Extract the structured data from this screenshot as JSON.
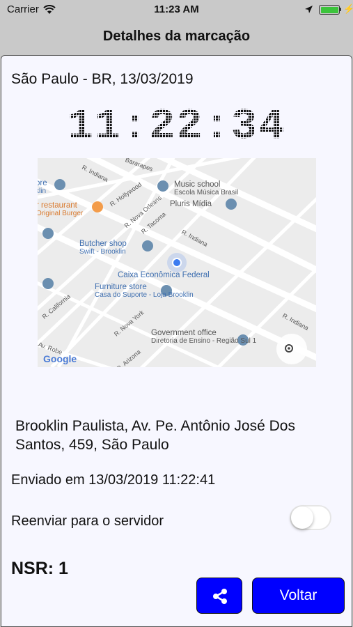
{
  "status_bar": {
    "carrier": "Carrier",
    "time": "11:23 AM",
    "battery_level": 1.0,
    "battery_color": "#3cc43c"
  },
  "nav": {
    "title": "Detalhes da marcação"
  },
  "details": {
    "location_date": "São Paulo - BR, 13/03/2019",
    "clock": "11:22:34",
    "address": "Brooklin Paulista, Av. Pe. Antônio José Dos Santos, 459, São Paulo",
    "sent_text": "Enviado em 13/03/2019 11:22:41",
    "resend_label": "Reenviar para o servidor",
    "resend_enabled": false,
    "nsr": "NSR: 1"
  },
  "map": {
    "pois": [
      {
        "title": "Music school",
        "subtitle": "Escola Música Brasil"
      },
      {
        "title": "r restaurant",
        "subtitle": "Original Burger"
      },
      {
        "title": "Pluris Mídia",
        "subtitle": ""
      },
      {
        "title": "Butcher shop",
        "subtitle": "Swift - Brooklin"
      },
      {
        "title": "Caixa Econômica Federal",
        "subtitle": ""
      },
      {
        "title": "Furniture store",
        "subtitle": "Casa do Suporte - Loja Brooklin"
      },
      {
        "title": "Government office",
        "subtitle": "Diretoria de Ensino - Região Sul 1"
      },
      {
        "title": "ore",
        "subtitle": "klin"
      }
    ],
    "streets": [
      "R. Indiana",
      "Bararapes",
      "R. Hollywood",
      "R. Nova Orleans",
      "R. Tacoma",
      "R. Indiana",
      "R. California",
      "R. Nova York",
      "R. Arizona",
      "Av. Robe",
      "R. Indiana"
    ],
    "logo": "Google"
  },
  "buttons": {
    "back_label": "Voltar",
    "accent_color": "#0000ff"
  }
}
